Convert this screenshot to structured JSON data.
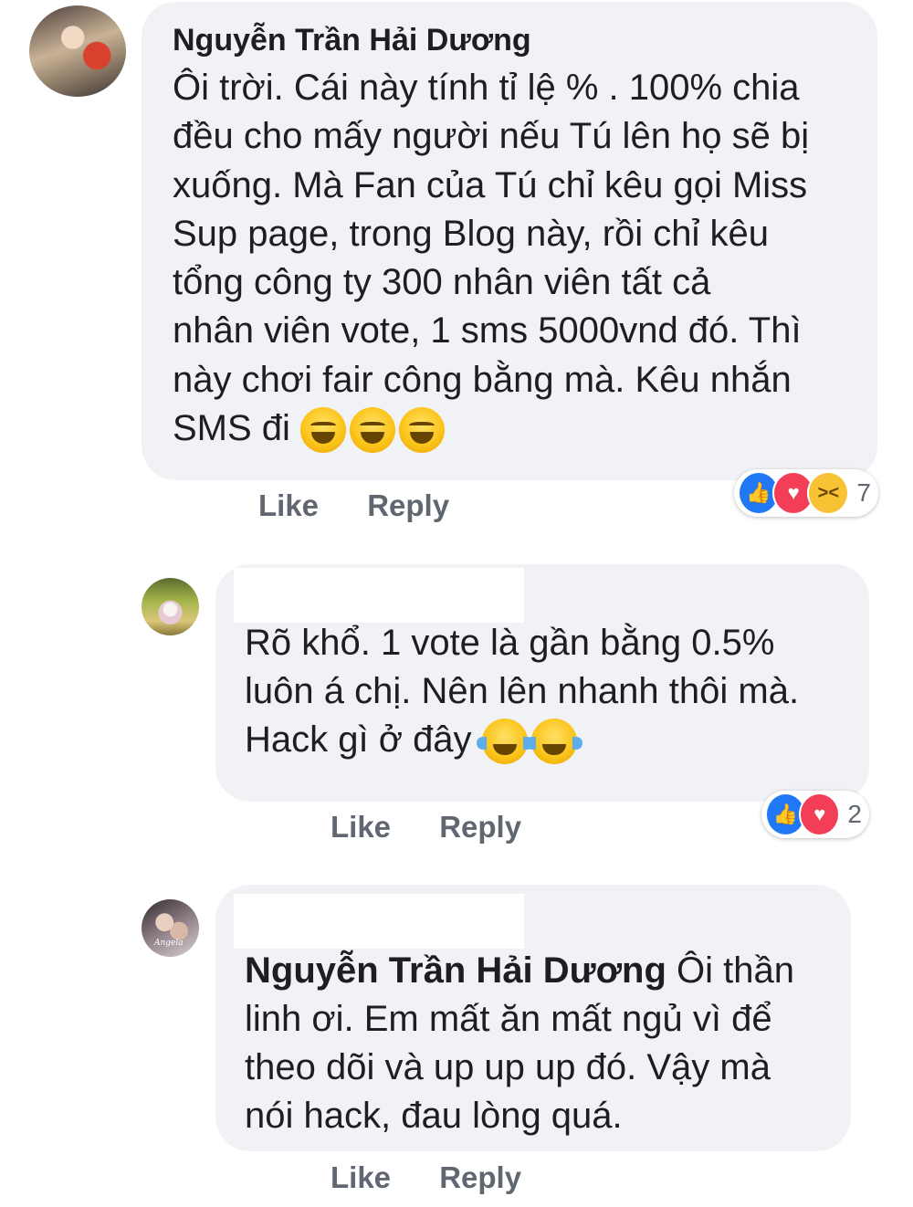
{
  "comments": [
    {
      "author": "Nguyễn Trần Hải Dương",
      "text": "Ôi trời. Cái này tính tỉ lệ % . 100% chia\nđều cho mấy người nếu Tú lên họ sẽ bị\nxuống. Mà Fan của Tú chỉ kêu gọi Miss\nSup page, trong Blog này, rồi chỉ kêu\ntổng công ty 300 nhân viên tất cả\nnhân viên vote, 1 sms 5000vnd đó. Thì\nnày chơi fair công bằng mà. Kêu nhắn\nSMS đi",
      "emoji": [
        "laughing-emoji",
        "laughing-emoji",
        "laughing-emoji"
      ],
      "like_label": "Like",
      "reply_label": "Reply",
      "reactions": [
        "like",
        "love",
        "haha"
      ],
      "reaction_count": "7"
    },
    {
      "author": "",
      "text": "Rõ khổ. 1 vote là gần bằng 0.5%\nluôn á chị. Nên lên nhanh thôi mà.\nHack gì ở đây",
      "emoji": [
        "tears-of-joy-emoji",
        "tears-of-joy-emoji"
      ],
      "like_label": "Like",
      "reply_label": "Reply",
      "reactions": [
        "like",
        "love"
      ],
      "reaction_count": "2"
    },
    {
      "author": "",
      "tag": "Nguyễn Trần Hải Dương",
      "text": " Ôi thần\nlinh ơi. Em mất ăn mất ngủ vì để\ntheo dõi và up up up đó. Vậy mà\nnói hack, đau lòng quá.",
      "like_label": "Like",
      "reply_label": "Reply"
    }
  ],
  "colors": {
    "bubble": "#f1f2f5",
    "like": "#2078f4",
    "love": "#f33e58",
    "haha": "#f7c234",
    "action_text": "#606770"
  }
}
